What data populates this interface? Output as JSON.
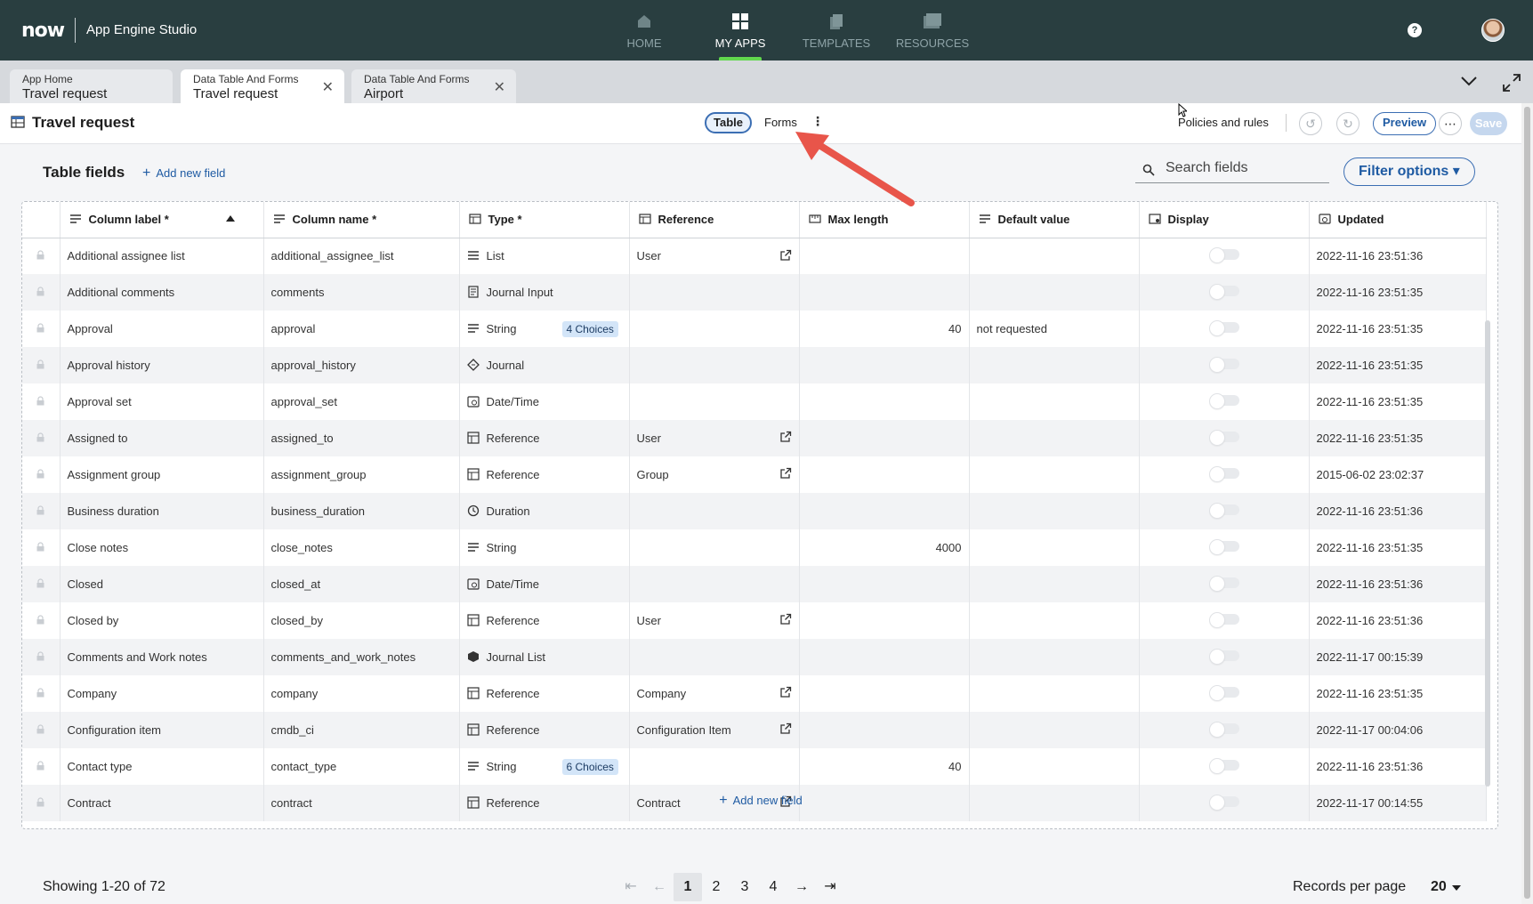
{
  "app": {
    "logo": "now",
    "name": "App Engine Studio"
  },
  "nav": [
    {
      "label": "HOME",
      "icon": "home-icon"
    },
    {
      "label": "MY APPS",
      "icon": "grid-icon",
      "active": true
    },
    {
      "label": "TEMPLATES",
      "icon": "templates-icon"
    },
    {
      "label": "RESOURCES",
      "icon": "resources-icon"
    }
  ],
  "tabs": [
    {
      "context": "App Home",
      "title": "Travel request"
    },
    {
      "context": "Data Table And Forms",
      "title": "Travel request"
    },
    {
      "context": "Data Table And Forms",
      "title": "Airport"
    }
  ],
  "header": {
    "title": "Travel request",
    "table_label": "Table",
    "forms_label": "Forms",
    "policies_label": "Policies and rules",
    "preview_label": "Preview",
    "save_label": "Save"
  },
  "section": {
    "title": "Table fields",
    "add_field": "Add new field",
    "search_placeholder": "Search fields",
    "filter_label": "Filter options"
  },
  "columns": [
    "Column label *",
    "Column name *",
    "Type *",
    "Reference",
    "Max length",
    "Default value",
    "Display",
    "Updated"
  ],
  "rows": [
    [
      "Additional assignee list",
      "additional_assignee_list",
      "List",
      "",
      "User",
      "",
      "",
      "2022-11-16 23:51:36"
    ],
    [
      "Additional comments",
      "comments",
      "Journal Input",
      "",
      "",
      "",
      "",
      "2022-11-16 23:51:35"
    ],
    [
      "Approval",
      "approval",
      "String",
      "4 Choices",
      "",
      "40",
      "not requested",
      "2022-11-16 23:51:35"
    ],
    [
      "Approval history",
      "approval_history",
      "Journal",
      "",
      "",
      "",
      "",
      "2022-11-16 23:51:35"
    ],
    [
      "Approval set",
      "approval_set",
      "Date/Time",
      "",
      "",
      "",
      "",
      "2022-11-16 23:51:35"
    ],
    [
      "Assigned to",
      "assigned_to",
      "Reference",
      "",
      "User",
      "",
      "",
      "2022-11-16 23:51:35"
    ],
    [
      "Assignment group",
      "assignment_group",
      "Reference",
      "",
      "Group",
      "",
      "",
      "2015-06-02 23:02:37"
    ],
    [
      "Business duration",
      "business_duration",
      "Duration",
      "",
      "",
      "",
      "",
      "2022-11-16 23:51:36"
    ],
    [
      "Close notes",
      "close_notes",
      "String",
      "",
      "",
      "4000",
      "",
      "2022-11-16 23:51:35"
    ],
    [
      "Closed",
      "closed_at",
      "Date/Time",
      "",
      "",
      "",
      "",
      "2022-11-16 23:51:36"
    ],
    [
      "Closed by",
      "closed_by",
      "Reference",
      "",
      "User",
      "",
      "",
      "2022-11-16 23:51:36"
    ],
    [
      "Comments and Work notes",
      "comments_and_work_notes",
      "Journal List",
      "",
      "",
      "",
      "",
      "2022-11-17 00:15:39"
    ],
    [
      "Company",
      "company",
      "Reference",
      "",
      "Company",
      "",
      "",
      "2022-11-16 23:51:35"
    ],
    [
      "Configuration item",
      "cmdb_ci",
      "Reference",
      "",
      "Configuration Item",
      "",
      "",
      "2022-11-17 00:04:06"
    ],
    [
      "Contact type",
      "contact_type",
      "String",
      "6 Choices",
      "",
      "40",
      "",
      "2022-11-16 23:51:36"
    ],
    [
      "Contract",
      "contract",
      "Reference",
      "",
      "Contract",
      "",
      "",
      "2022-11-17 00:14:55"
    ]
  ],
  "footer": {
    "showing": "Showing 1-20 of 72",
    "pages": [
      "1",
      "2",
      "3",
      "4"
    ],
    "records_label": "Records per page",
    "records_value": "20"
  },
  "colors": {
    "nav_bg": "#293e40",
    "accent": "#1f5ba3",
    "active_bar": "#62d84e",
    "arrow": "#e8554a"
  }
}
